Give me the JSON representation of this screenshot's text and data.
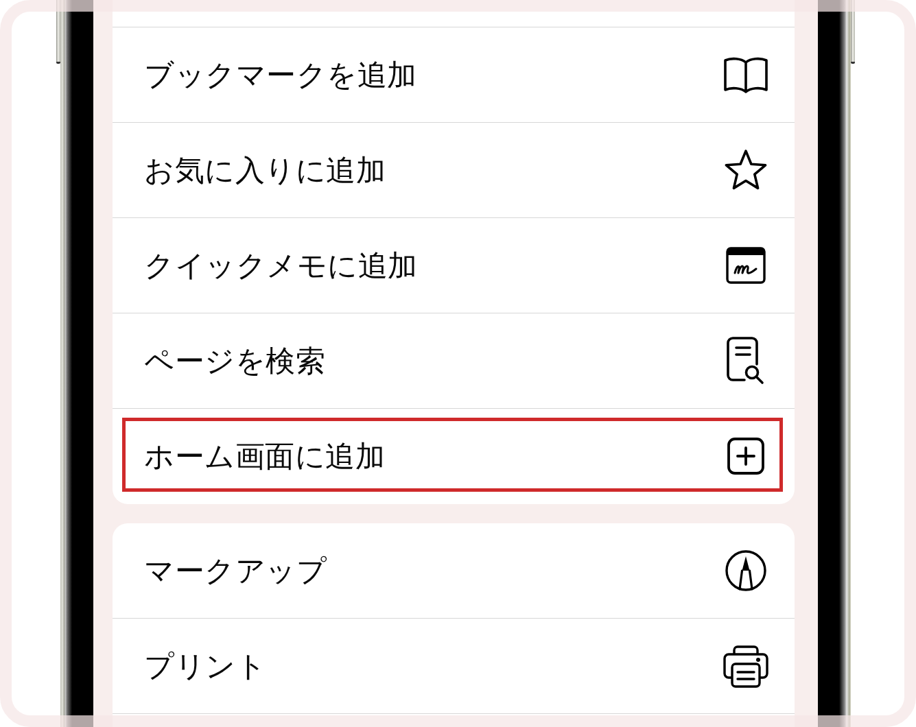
{
  "groups": [
    {
      "items": [
        {
          "label": "ブックマークを追加",
          "kind": "bookmark",
          "highlighted": false
        },
        {
          "label": "お気に入りに追加",
          "kind": "favorite",
          "highlighted": false
        },
        {
          "label": "クイックメモに追加",
          "kind": "quicknote",
          "highlighted": false
        },
        {
          "label": "ページを検索",
          "kind": "find",
          "highlighted": false
        },
        {
          "label": "ホーム画面に追加",
          "kind": "homescreen",
          "highlighted": true
        }
      ]
    },
    {
      "items": [
        {
          "label": "マークアップ",
          "kind": "markup",
          "highlighted": false
        },
        {
          "label": "プリント",
          "kind": "print",
          "highlighted": false
        }
      ]
    }
  ]
}
